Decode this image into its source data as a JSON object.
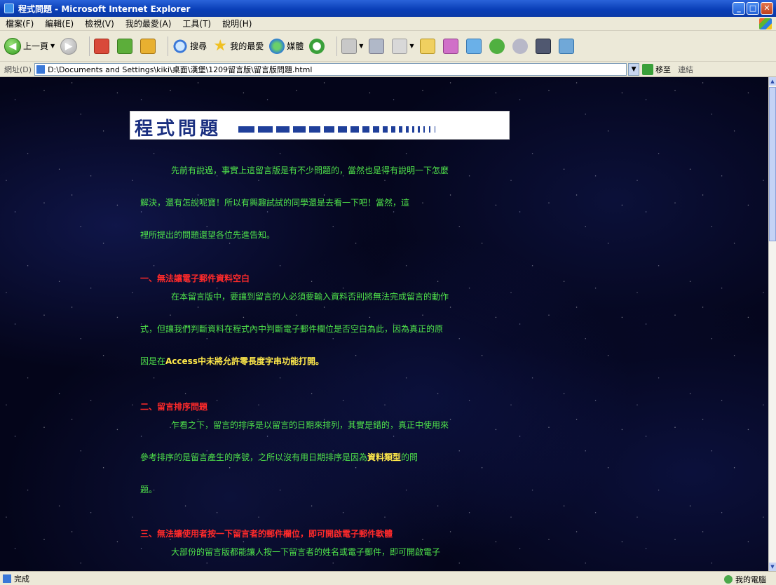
{
  "window": {
    "title": "程式問題 - Microsoft Internet Explorer"
  },
  "menubar": {
    "items": [
      "檔案(F)",
      "編輯(E)",
      "檢視(V)",
      "我的最愛(A)",
      "工具(T)",
      "說明(H)"
    ]
  },
  "toolbar": {
    "back_label": "上一頁",
    "search_label": "搜尋",
    "favorites_label": "我的最愛",
    "media_label": "媒體"
  },
  "address": {
    "label": "網址(D)",
    "value": "D:\\Documents and Settings\\kiki\\桌面\\漢堡\\1209留言版\\留言版問題.html",
    "go_label": "移至",
    "links_label": "連結"
  },
  "page": {
    "banner_title": "程式問題",
    "intro": [
      "先前有說過，事實上這留言版是有不少問題的，當然也是得有說明一下怎麼",
      "解決，還有怎說呢寶！所以有興趣試試的同學還是去看一下吧！當然，這",
      "裡所提出的問題還望各位先進告知。"
    ],
    "section1": {
      "heading": "一、無法讓電子郵件資料空白",
      "lines": [
        "在本留言版中，要讓到留言的人必須要輸入資料否則將無法完成留言的動作",
        "式，但讓我們判斷資料在程式內中判斷電子郵件欄位是否空白為此，因為真正的原"
      ],
      "line3_prefix": "因是在",
      "line3_highlight": "Access中未將允許零長度字串功能打開。"
    },
    "section2": {
      "heading": "二、留言排序問題",
      "line1": "乍看之下，留言的排序是以留言的日期來排列，其實是錯的，真正中使用來",
      "line2_prefix": "參考排序的是留言產生的序號，之所以沒有用日期排序是因為",
      "line2_highlight": "資料類型",
      "line2_suffix": "的問",
      "line3": "題。"
    },
    "section3": {
      "heading": "三、無法讓使用者按一下留言者的郵件欄位，即可開啟電子郵件軟體",
      "line1": "大部份的留言版都能讓人按一下留言者的姓名或電子郵件，即可開啟電子"
    }
  },
  "status": {
    "left": "完成",
    "zone": "我的電腦"
  },
  "colors": {
    "body_text": "#4fe24a",
    "heading": "#ff2a2a",
    "highlight": "#ffe94a",
    "banner_text": "#1a2f80"
  }
}
